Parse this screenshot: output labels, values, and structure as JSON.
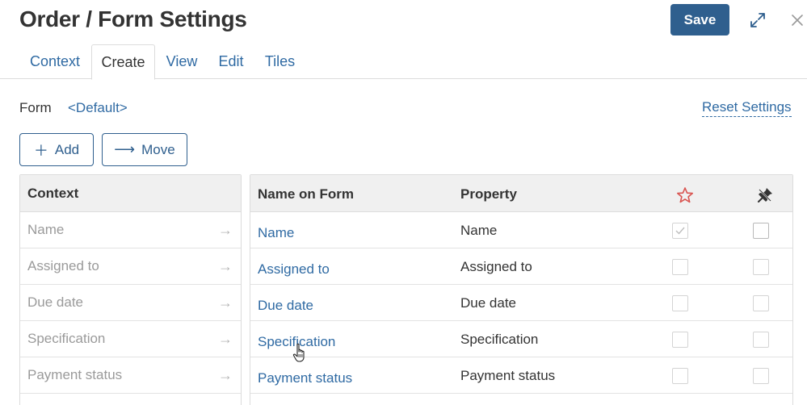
{
  "header": {
    "title": "Order / Form Settings",
    "save_label": "Save"
  },
  "tabs": [
    {
      "label": "Context"
    },
    {
      "label": "Create"
    },
    {
      "label": "View"
    },
    {
      "label": "Edit"
    },
    {
      "label": "Tiles"
    }
  ],
  "active_tab": "Create",
  "form": {
    "label": "Form",
    "value": "<Default>",
    "reset_label": "Reset Settings"
  },
  "actions": {
    "add_label": "Add",
    "move_label": "Move"
  },
  "context_panel": {
    "header": "Context",
    "items": [
      {
        "label": "Name"
      },
      {
        "label": "Assigned to"
      },
      {
        "label": "Due date"
      },
      {
        "label": "Specification"
      },
      {
        "label": "Payment status"
      }
    ]
  },
  "fields_table": {
    "columns": {
      "name_on_form": "Name on Form",
      "property": "Property",
      "required_icon": "star-icon",
      "hidden_icon": "pin-icon"
    },
    "rows": [
      {
        "name": "Name",
        "property": "Name",
        "required": true,
        "hidden": false
      },
      {
        "name": "Assigned to",
        "property": "Assigned to",
        "required": false,
        "hidden": false
      },
      {
        "name": "Due date",
        "property": "Due date",
        "required": false,
        "hidden": false
      },
      {
        "name": "Specification",
        "property": "Specification",
        "required": false,
        "hidden": false
      },
      {
        "name": "Payment status",
        "property": "Payment status",
        "required": false,
        "hidden": false
      }
    ]
  },
  "colors": {
    "accent": "#2f5f8e",
    "link": "#2f6aa3",
    "star": "#d9534f"
  }
}
